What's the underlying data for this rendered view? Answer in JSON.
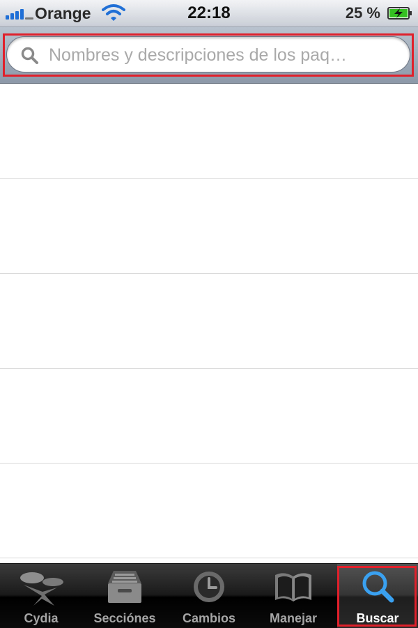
{
  "status_bar": {
    "carrier": "Orange",
    "time": "22:18",
    "battery": "25 %"
  },
  "search": {
    "placeholder": "Nombres y descripciones de los paq…",
    "value": ""
  },
  "results": [
    {
      "label": ""
    },
    {
      "label": ""
    },
    {
      "label": ""
    },
    {
      "label": ""
    },
    {
      "label": ""
    }
  ],
  "tab_bar": {
    "tabs": [
      {
        "label": "Cydia",
        "icon": "cydia-icon"
      },
      {
        "label": "Secciónes",
        "icon": "sections-icon"
      },
      {
        "label": "Cambios",
        "icon": "clock-icon"
      },
      {
        "label": "Manejar",
        "icon": "book-icon"
      },
      {
        "label": "Buscar",
        "icon": "search-icon",
        "active": true
      }
    ]
  },
  "colors": {
    "highlight": "#e0202a",
    "accent": "#1f6fd6",
    "battery_fill": "#34c021"
  }
}
